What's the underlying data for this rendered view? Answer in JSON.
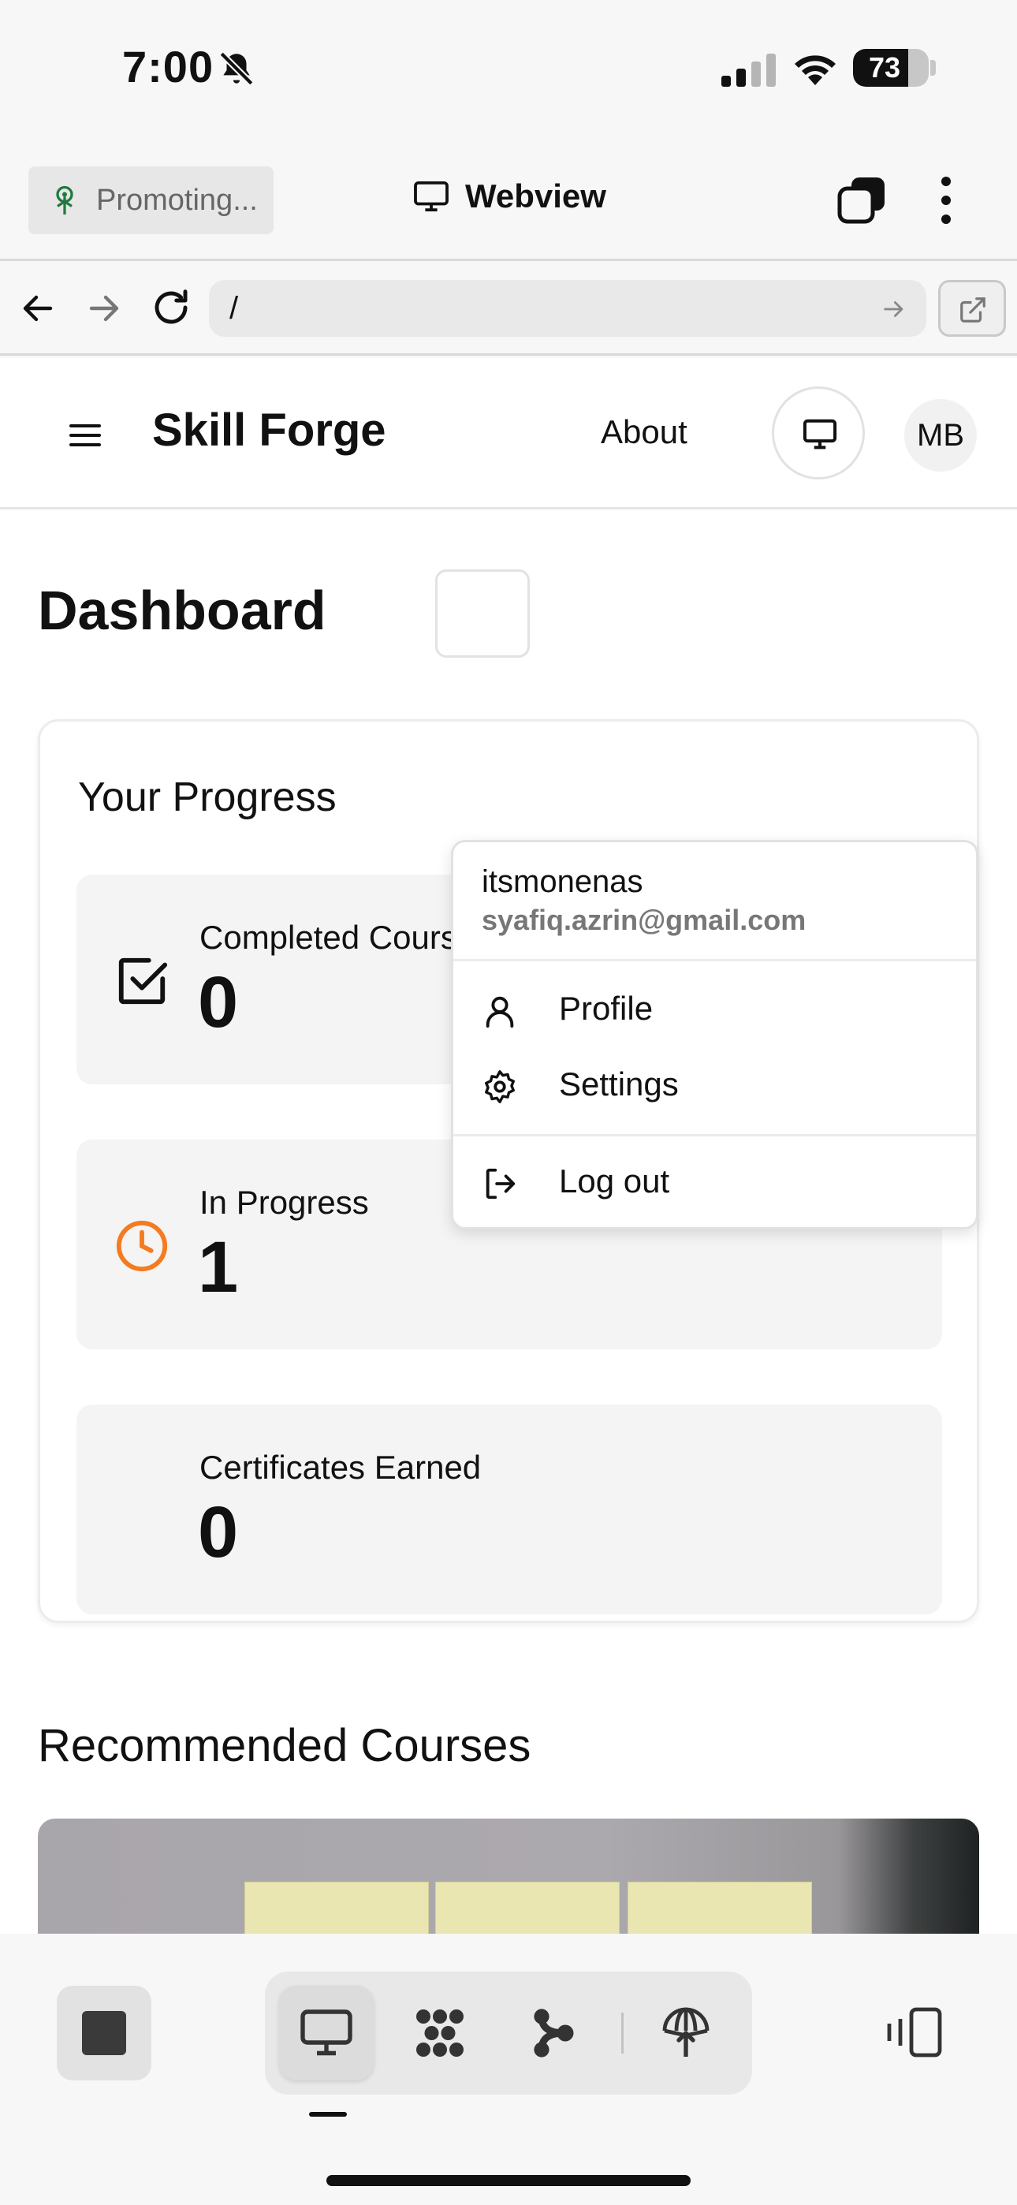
{
  "status_bar": {
    "time": "7:00",
    "battery": "73",
    "battery_level": 0.73
  },
  "browser": {
    "promo_label": "Promoting...",
    "title": "Webview",
    "url": "/"
  },
  "site": {
    "brand": "Skill Forge",
    "about_label": "About",
    "avatar_initials": "MB"
  },
  "user_menu": {
    "username": "itsmonenas",
    "email": "syafiq.azrin@gmail.com",
    "items": [
      {
        "label": "Profile",
        "icon": "user-icon"
      },
      {
        "label": "Settings",
        "icon": "gear-icon"
      },
      {
        "label": "Log out",
        "icon": "logout-icon"
      }
    ]
  },
  "dashboard": {
    "title": "Dashboard",
    "progress_heading": "Your Progress",
    "stats": [
      {
        "label": "Completed Courses",
        "value": "0",
        "icon": "check-square-icon"
      },
      {
        "label": "In Progress",
        "value": "1",
        "icon": "clock-icon",
        "icon_color": "#f47b20"
      },
      {
        "label": "Certificates Earned",
        "value": "0",
        "icon": ""
      }
    ],
    "recommended_heading": "Recommended Courses"
  },
  "bottom_toolbar": {
    "icons": [
      "stop-icon",
      "monitor-icon",
      "network-icon",
      "flow-icon",
      "upload-globe-icon",
      "device-rotate-icon"
    ]
  }
}
